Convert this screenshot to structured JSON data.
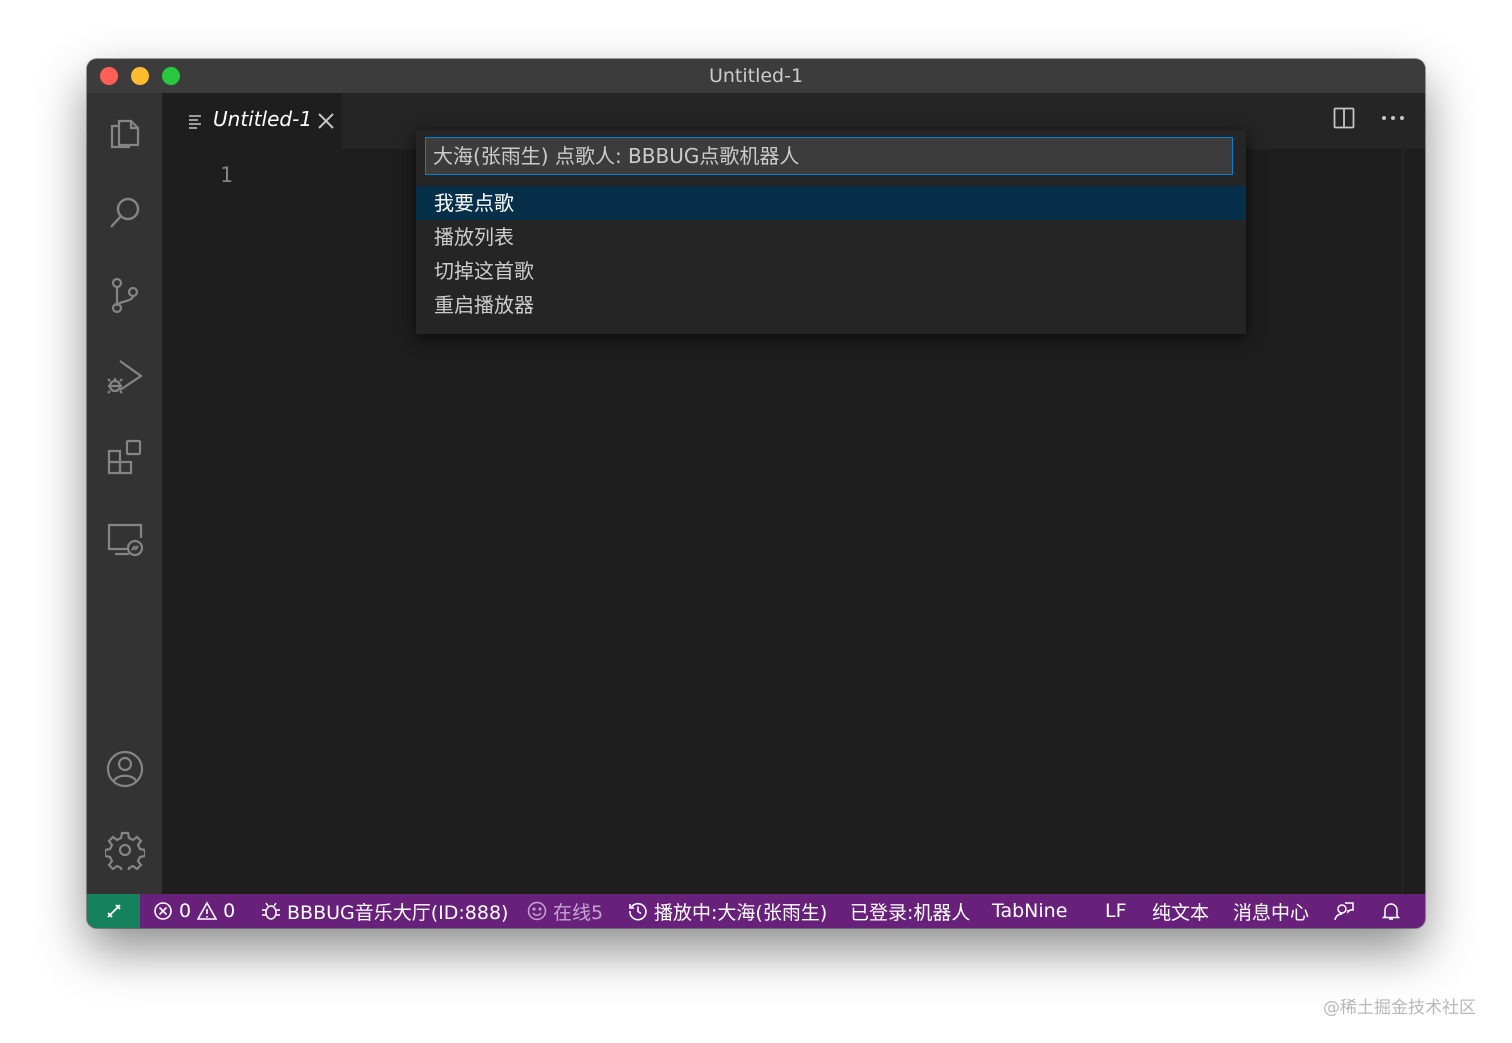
{
  "window": {
    "title": "Untitled-1"
  },
  "tab": {
    "title": "Untitled-1",
    "close": "×"
  },
  "editor": {
    "line_number": "1"
  },
  "quick_pick": {
    "placeholder": "大海(张雨生) 点歌人: BBBUG点歌机器人",
    "items": [
      {
        "label": "我要点歌",
        "selected": true
      },
      {
        "label": "播放列表",
        "selected": false
      },
      {
        "label": "切掉这首歌",
        "selected": false
      },
      {
        "label": "重启播放器",
        "selected": false
      }
    ]
  },
  "activity_bar": {
    "icons": [
      "explorer-icon",
      "search-icon",
      "source-control-icon",
      "run-debug-icon",
      "extensions-icon",
      "remote-explorer-icon",
      "account-icon",
      "settings-gear-icon"
    ]
  },
  "status_bar": {
    "errors": "0",
    "warnings": "0",
    "room": "BBBUG音乐大厅(ID:888)",
    "online": "在线5",
    "playing": "播放中:大海(张雨生)",
    "login": "已登录:机器人",
    "tabnine": "TabNine",
    "eol": "LF",
    "language": "纯文本",
    "messages": "消息中心"
  },
  "colors": {
    "status_bar": "#68217a",
    "remote_indicator": "#16825d",
    "selection": "#062f4a",
    "focus_border": "#007fd4"
  },
  "watermark": "@稀土掘金技术社区"
}
